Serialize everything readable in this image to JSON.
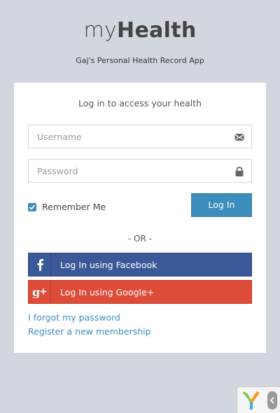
{
  "app": {
    "title_light": "my",
    "title_bold": "Health",
    "subtitle": "Gaj's Personal Health Record App"
  },
  "login": {
    "message": "Log in to access your health",
    "username_placeholder": "Username",
    "password_placeholder": "Password",
    "remember_label": "Remember Me",
    "remember_checked": true,
    "submit_label": "Log In",
    "or_label": "- OR -",
    "facebook_label": "Log In using Facebook",
    "google_label": "Log In using Google+",
    "forgot_label": "I forgot my password",
    "register_label": "Register a new membership"
  },
  "icons": {
    "username": "envelope-icon",
    "password": "lock-icon",
    "facebook": "facebook-icon",
    "google": "google-plus-icon",
    "debug": "yii-logo-icon"
  },
  "colors": {
    "background": "#d2d6de",
    "primary": "#3c8dbc",
    "facebook": "#3b5998",
    "google": "#dd4b39"
  }
}
